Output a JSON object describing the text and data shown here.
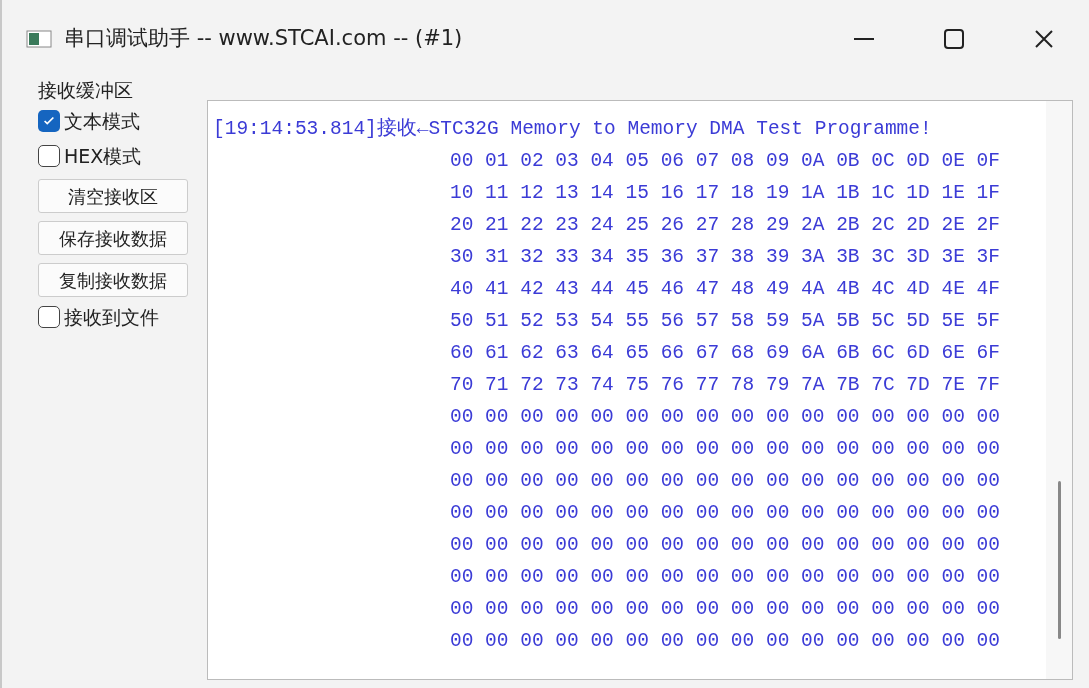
{
  "window": {
    "title": "串口调试助手 -- www.STCAI.com -- (#1)"
  },
  "receive_panel": {
    "title": "接收缓冲区",
    "items": [
      {
        "kind": "checkbox",
        "label": "文本模式",
        "checked": true
      },
      {
        "kind": "checkbox",
        "label": "HEX模式",
        "checked": false
      },
      {
        "kind": "button",
        "label": "清空接收区"
      },
      {
        "kind": "button",
        "label": "保存接收数据"
      },
      {
        "kind": "button",
        "label": "复制接收数据"
      },
      {
        "kind": "checkbox",
        "label": "接收到文件",
        "checked": false
      }
    ]
  },
  "receive_area": {
    "header": "[19:14:53.814]接收←STC32G Memory to Memory DMA Test Programme!",
    "rows": [
      "00 01 02 03 04 05 06 07 08 09 0A 0B 0C 0D 0E 0F",
      "10 11 12 13 14 15 16 17 18 19 1A 1B 1C 1D 1E 1F",
      "20 21 22 23 24 25 26 27 28 29 2A 2B 2C 2D 2E 2F",
      "30 31 32 33 34 35 36 37 38 39 3A 3B 3C 3D 3E 3F",
      "40 41 42 43 44 45 46 47 48 49 4A 4B 4C 4D 4E 4F",
      "50 51 52 53 54 55 56 57 58 59 5A 5B 5C 5D 5E 5F",
      "60 61 62 63 64 65 66 67 68 69 6A 6B 6C 6D 6E 6F",
      "70 71 72 73 74 75 76 77 78 79 7A 7B 7C 7D 7E 7F",
      "00 00 00 00 00 00 00 00 00 00 00 00 00 00 00 00",
      "00 00 00 00 00 00 00 00 00 00 00 00 00 00 00 00",
      "00 00 00 00 00 00 00 00 00 00 00 00 00 00 00 00",
      "00 00 00 00 00 00 00 00 00 00 00 00 00 00 00 00",
      "00 00 00 00 00 00 00 00 00 00 00 00 00 00 00 00",
      "00 00 00 00 00 00 00 00 00 00 00 00 00 00 00 00",
      "00 00 00 00 00 00 00 00 00 00 00 00 00 00 00 00",
      "00 00 00 00 00 00 00 00 00 00 00 00 00 00 00 00"
    ]
  }
}
